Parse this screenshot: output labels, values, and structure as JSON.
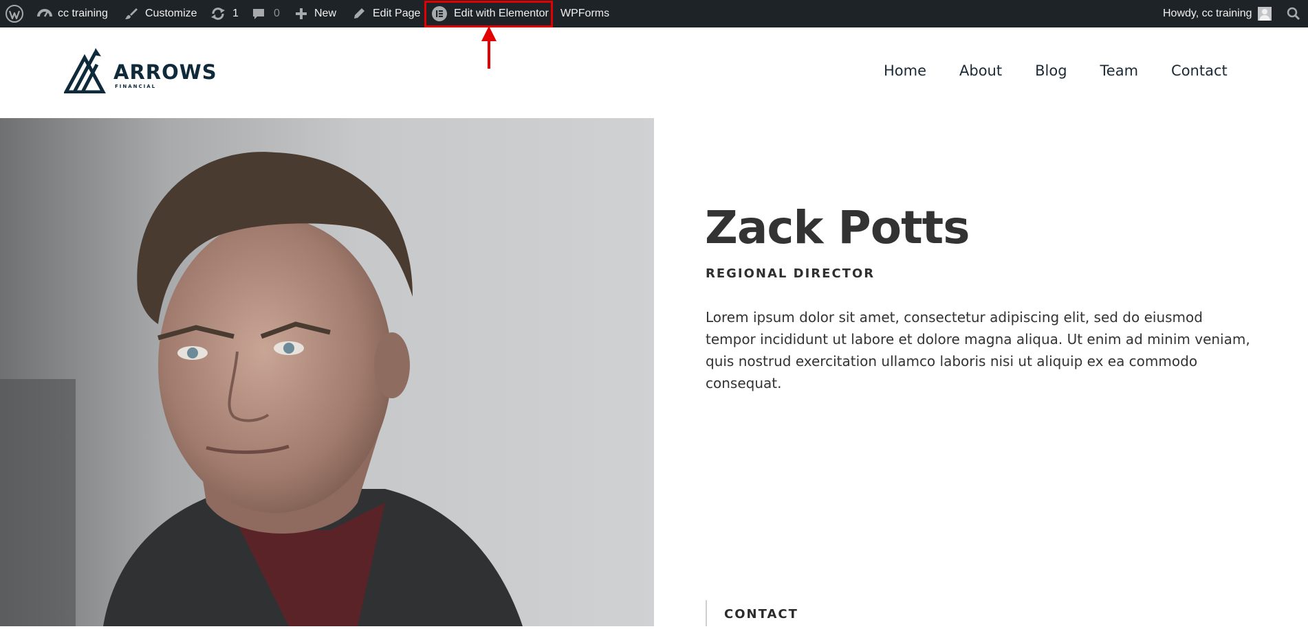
{
  "adminbar": {
    "site_name": "cc training",
    "customize": "Customize",
    "updates_count": "1",
    "comments_count": "0",
    "new": "New",
    "edit_page": "Edit Page",
    "edit_with_elementor": "Edit with Elementor",
    "wpforms": "WPForms",
    "howdy": "Howdy, cc training",
    "icons": [
      "wordpress-logo-icon",
      "dashboard-icon",
      "brush-icon",
      "updates-icon",
      "comment-icon",
      "plus-icon",
      "pencil-icon",
      "elementor-icon",
      "avatar",
      "search-icon"
    ],
    "highlight_color": "#e30000"
  },
  "site": {
    "logo_word": "ARROWS",
    "logo_sub": "FINANCIAL",
    "nav": [
      "Home",
      "About",
      "Blog",
      "Team",
      "Contact"
    ]
  },
  "profile": {
    "name": "Zack Potts",
    "role": "REGIONAL DIRECTOR",
    "bio": "Lorem ipsum dolor sit amet, consectetur adipiscing elit, sed do eiusmod tempor incididunt ut labore et dolore magna aliqua. Ut enim ad minim veniam, quis nostrud exercitation ullamco laboris nisi ut aliquip ex ea commodo consequat.",
    "contact_heading": "CONTACT"
  },
  "colors": {
    "adminbar_bg": "#1d2327",
    "brand_dark": "#0f2a3a",
    "text": "#333333"
  }
}
